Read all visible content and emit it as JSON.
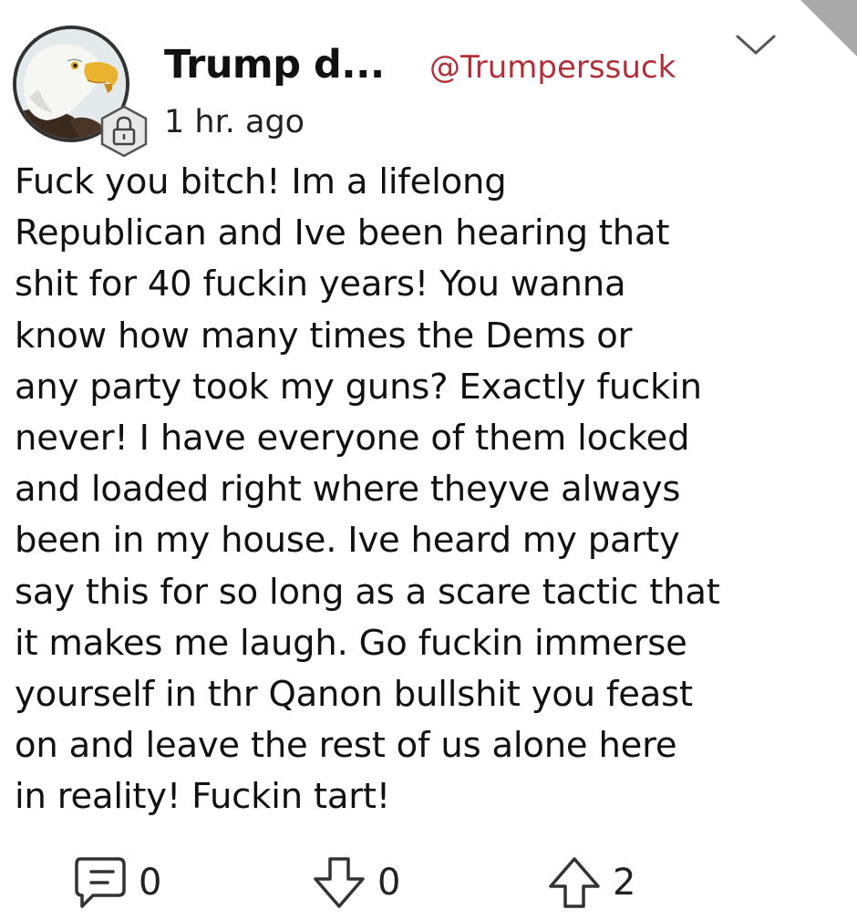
{
  "post": {
    "author_name": "Trump d...",
    "author_handle": "@Trumperssuck",
    "timestamp": "1 hr. ago",
    "body": "Fuck you bitch! Im a lifelong\nRepublican and Ive been hearing that\nshit for 40 fuckin years! You wanna\nknow how many times the Dems or\nany party took my guns? Exactly fuckin\nnever! I have everyone of them locked\nand loaded right where theyve always\nbeen in my house. Ive heard my party\nsay this for so long as a scare tactic that\nit makes me laugh. Go fuckin immerse\nyourself in thr Qanon bullshit you feast\non and leave the rest of us alone here\nin reality! Fuckin tart!",
    "avatar_icon": "bald-eagle-avatar",
    "badge_icon": "lock-icon"
  },
  "actions": {
    "comments_count": "0",
    "downvotes_count": "0",
    "upvotes_count": "2",
    "comment_icon": "comment-icon",
    "downvote_icon": "arrow-down-icon",
    "upvote_icon": "arrow-up-icon",
    "menu_icon": "chevron-down-icon"
  },
  "colors": {
    "handle": "#b0303a",
    "text": "#111111",
    "corner": "#a9a9a9"
  }
}
